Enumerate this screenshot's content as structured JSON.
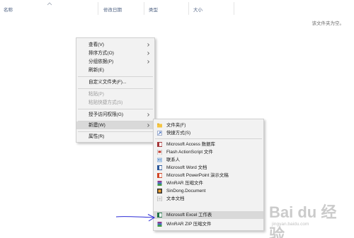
{
  "explorer": {
    "columns": {
      "name": "名称",
      "date_modified": "修改日期",
      "type": "类型",
      "size": "大小"
    },
    "empty_message": "该文件夹为空。"
  },
  "context_menu": {
    "view": "查看(V)",
    "sort_by": "排序方式(O)",
    "group_by": "分组依据(P)",
    "refresh": "刷新(E)",
    "customize_folder": "自定义文件夹(F)...",
    "paste": "粘贴(P)",
    "paste_shortcut": "粘贴快捷方式(S)",
    "give_access": "授予访问权限(G)",
    "new": "新建(W)",
    "properties": "属性(R)"
  },
  "new_submenu": {
    "items": [
      {
        "label": "文件夹(F)",
        "icon": "folder-icon"
      },
      {
        "label": "快捷方式(S)",
        "icon": "shortcut-icon"
      },
      {
        "label": "Microsoft Access 数据库",
        "icon": "access-icon"
      },
      {
        "label": "Flash ActionScript 文件",
        "icon": "flash-file-icon"
      },
      {
        "label": "联系人",
        "icon": "contact-icon"
      },
      {
        "label": "Microsoft Word 文档",
        "icon": "word-icon"
      },
      {
        "label": "Microsoft PowerPoint 演示文稿",
        "icon": "powerpoint-icon"
      },
      {
        "label": "WinRAR 压缩文件",
        "icon": "winrar-icon"
      },
      {
        "label": "SinDong.Document",
        "icon": "sindong-icon"
      },
      {
        "label": "文本文档",
        "icon": "text-document-icon"
      },
      {
        "label": "Microsoft Excel 工作表",
        "icon": "excel-icon"
      },
      {
        "label": "WinRAR ZIP 压缩文件",
        "icon": "winrar-zip-icon"
      }
    ]
  },
  "colors": {
    "menu_bg": "#f2f2f2",
    "highlight": "#d9d9d9",
    "annotation_arrow": "#2b2bd6",
    "header_text": "#4d6082"
  },
  "watermark": {
    "logo": "Bai du 经验",
    "url": "jingyan.baidu.com"
  }
}
